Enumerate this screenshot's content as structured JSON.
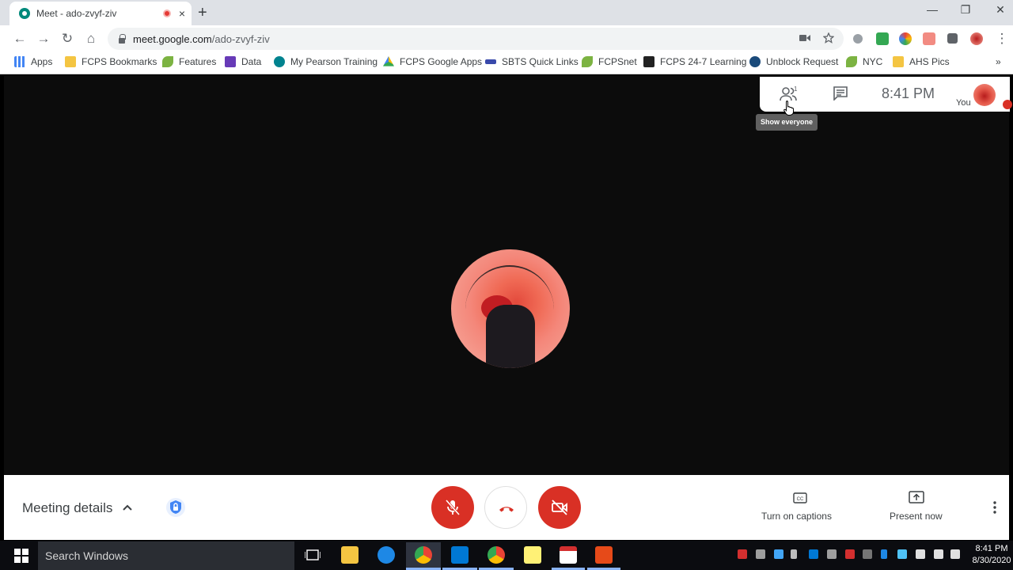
{
  "browser": {
    "tab_title": "Meet - ado-zvyf-ziv",
    "tab_close": "×",
    "new_tab": "+",
    "url_host": "meet.google.com",
    "url_path": "/ado-zvyf-ziv",
    "window_controls": {
      "minimize": "—",
      "restore": "❐",
      "close": "✕"
    },
    "nav": {
      "back": "←",
      "forward": "→",
      "reload": "↻",
      "home": "⌂",
      "menu": "⋮"
    }
  },
  "bookmarks": [
    {
      "label": "Apps",
      "icon": "apps-grid-icon",
      "color": "#4285f4"
    },
    {
      "label": "FCPS Bookmarks",
      "icon": "folder-icon",
      "color": "#f4c542"
    },
    {
      "label": "Features",
      "icon": "leaf-icon",
      "color": "#7cb342"
    },
    {
      "label": "Data",
      "icon": "forms-icon",
      "color": "#673ab7"
    },
    {
      "label": "My Pearson Training",
      "icon": "pearson-icon",
      "color": "#00838f"
    },
    {
      "label": "FCPS Google Apps",
      "icon": "drive-icon",
      "color": "#fbbc04"
    },
    {
      "label": "SBTS Quick Links",
      "icon": "sbts-icon",
      "color": "#3949ab"
    },
    {
      "label": "FCPSnet",
      "icon": "leaf-icon",
      "color": "#7cb342"
    },
    {
      "label": "FCPS 24-7 Learning",
      "icon": "blackboard-icon",
      "color": "#222222"
    },
    {
      "label": "Unblock Request",
      "icon": "r-icon",
      "color": "#1a4a7a"
    },
    {
      "label": "NYC",
      "icon": "leaf-icon",
      "color": "#7cb342"
    },
    {
      "label": "AHS Pics",
      "icon": "folder-icon",
      "color": "#f4c542"
    }
  ],
  "bookmarks_overflow": "»",
  "meet": {
    "people_count": "1",
    "clock": "8:41 PM",
    "you_label": "You",
    "tooltip": "Show everyone",
    "meeting_details": "Meeting details",
    "captions_label": "Turn on captions",
    "present_label": "Present now"
  },
  "taskbar": {
    "search_placeholder": "Search Windows",
    "time": "8:41 PM",
    "date": "8/30/2020"
  },
  "colors": {
    "accent_red": "#d93025",
    "stage": "#0c0c0c",
    "chrome_bg": "#dee1e6"
  }
}
